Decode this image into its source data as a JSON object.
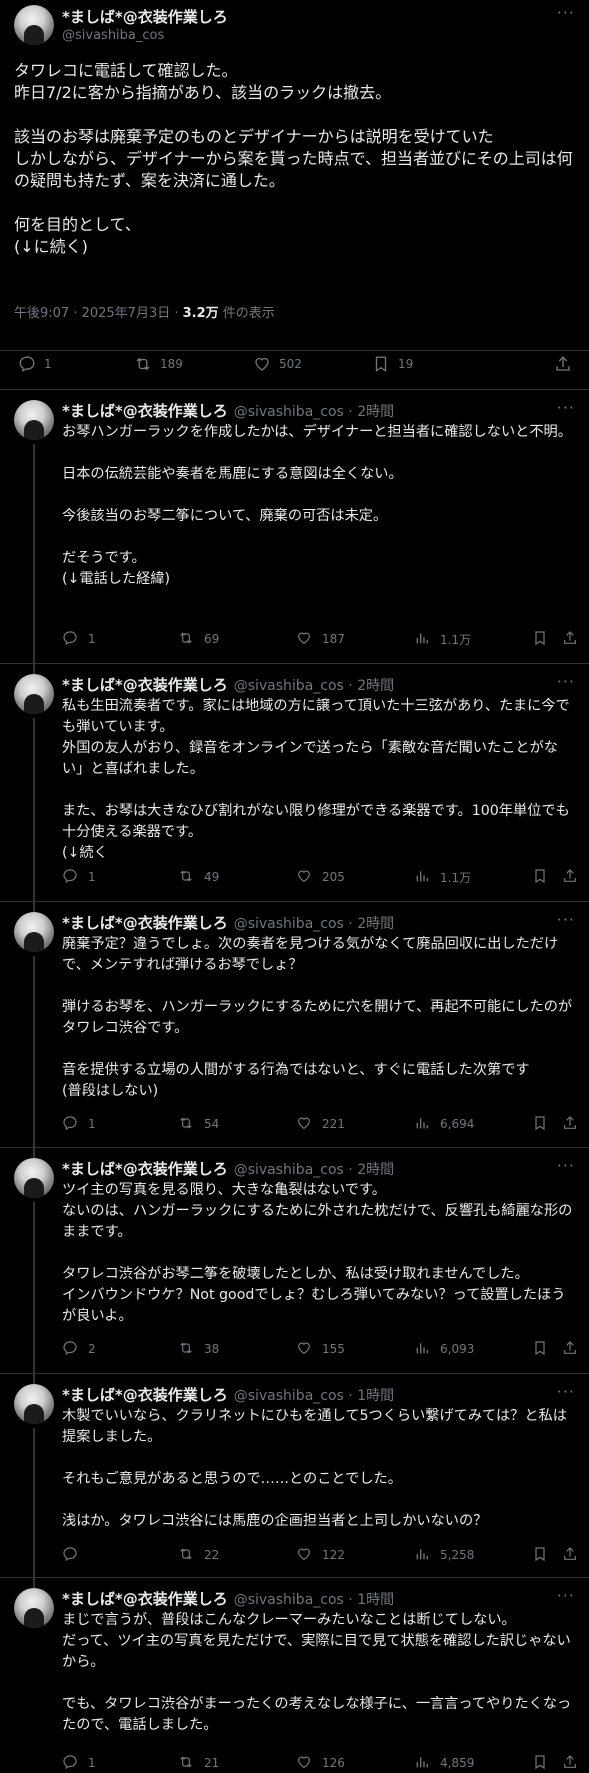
{
  "main": {
    "name": "*ましば*@衣装作業しろ",
    "handle": "@sivashiba_cos",
    "more": "···",
    "body": "タワレコに電話して確認した。\n昨日7/2に客から指摘があり、該当のラックは撤去。\n\n該当のお琴は廃棄予定のものとデザイナーからは説明を受けていた\nしかしながら、デザイナーから案を貰った時点で、担当者並びにその上司は何の疑問も持たず、案を決済に通した。\n\n何を目的として、\n(↓に続く)",
    "timestamp": "午後9:07 · 2025年7月3日 · ",
    "views": "3.2万",
    "views_suffix": " 件の表示",
    "replies": "1",
    "reposts": "189",
    "likes": "502",
    "bookmarks": "19"
  },
  "replies": [
    {
      "name": "*ましば*@衣装作業しろ",
      "handle": "@sivashiba_cos",
      "time": " · 2時間",
      "more": "···",
      "body": "お琴ハンガーラックを作成したかは、デザイナーと担当者に確認しないと不明。\n\n日本の伝統芸能や奏者を馬鹿にする意図は全くない。\n\n今後該当のお琴二筝について、廃棄の可否は未定。\n\nだそうです。\n(↓電話した経緯)",
      "replies": "1",
      "reposts": "69",
      "likes": "187",
      "views": "1.1万"
    },
    {
      "name": "*ましば*@衣装作業しろ",
      "handle": "@sivashiba_cos",
      "time": " · 2時間",
      "more": "···",
      "body": "私も生田流奏者です。家には地域の方に譲って頂いた十三弦があり、たまに今でも弾いています。\n外国の友人がおり、録音をオンラインで送ったら「素敵な音だ聞いたことがない」と喜ばれました。\n\nまた、お琴は大きなひび割れがない限り修理ができる楽器です。100年単位でも十分使える楽器です。\n(↓続く",
      "replies": "1",
      "reposts": "49",
      "likes": "205",
      "views": "1.1万"
    },
    {
      "name": "*ましば*@衣装作業しろ",
      "handle": "@sivashiba_cos",
      "time": " · 2時間",
      "more": "···",
      "body": "廃棄予定？違うでしょ。次の奏者を見つける気がなくて廃品回収に出しただけで、メンテすれば弾けるお琴でしょ？\n\n弾けるお琴を、ハンガーラックにするために穴を開けて、再起不可能にしたのがタワレコ渋谷です。\n\n音を提供する立場の人間がする行為ではないと、すぐに電話した次第です\n(普段はしない)",
      "replies": "1",
      "reposts": "54",
      "likes": "221",
      "views": "6,694"
    },
    {
      "name": "*ましば*@衣装作業しろ",
      "handle": "@sivashiba_cos",
      "time": " · 2時間",
      "more": "···",
      "body": "ツイ主の写真を見る限り、大きな亀裂はないです。\nないのは、ハンガーラックにするために外された枕だけで、反響孔も綺麗な形のままです。\n\nタワレコ渋谷がお琴二筝を破壊したとしか、私は受け取れませんでした。\nインバウンドウケ？Not goodでしょ？むしろ弾いてみない？って設置したほうが良いよ。",
      "replies": "2",
      "reposts": "38",
      "likes": "155",
      "views": "6,093"
    },
    {
      "name": "*ましば*@衣装作業しろ",
      "handle": "@sivashiba_cos",
      "time": " · 1時間",
      "more": "···",
      "body": "木製でいいなら、クラリネットにひもを通して5つくらい繋げてみては？と私は提案しました。\n\nそれもご意見があると思うので……とのことでした。\n\n浅はか。タワレコ渋谷には馬鹿の企画担当者と上司しかいないの？",
      "replies": "",
      "reposts": "22",
      "likes": "122",
      "views": "5,258"
    },
    {
      "name": "*ましば*@衣装作業しろ",
      "handle": "@sivashiba_cos",
      "time": " · 1時間",
      "more": "···",
      "body": "まじで言うが、普段はこんなクレーマーみたいなことは断じてしない。\nだって、ツイ主の写真を見ただけで、実際に目で見て状態を確認した訳じゃないから。\n\nでも、タワレコ渋谷がまーったくの考えなしな様子に、一言言ってやりたくなったので、電話しました。",
      "replies": "1",
      "reposts": "21",
      "likes": "126",
      "views": "4,859"
    }
  ]
}
